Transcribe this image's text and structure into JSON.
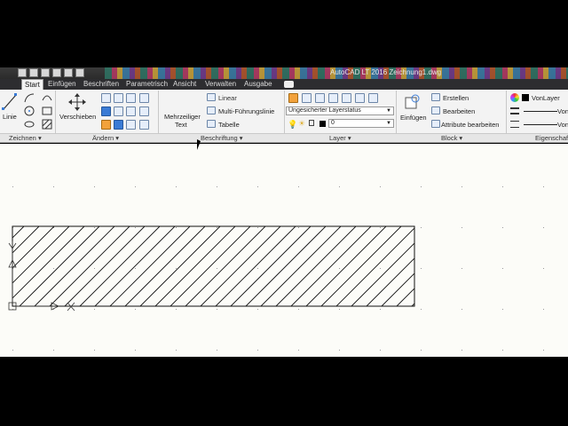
{
  "window": {
    "title": "AutoCAD LT 2016    Zeichnung1.dwg"
  },
  "tabs": [
    "Start",
    "Einfügen",
    "Beschriften",
    "Parametrisch",
    "Ansicht",
    "Verwalten",
    "Ausgabe"
  ],
  "ribbon": {
    "zeichnen": {
      "linie": "Linie"
    },
    "aendern": {
      "verschieben": "Verschieben"
    },
    "beschriftung": {
      "mehrzeiliger": "Mehrzeiliger",
      "text": "Text",
      "linear": "Linear",
      "multi": "Multi-Führungslinie",
      "tabelle": "Tabelle"
    },
    "layer": {
      "status": "Ungesicherter Layerstatus",
      "current": "0"
    },
    "block": {
      "einfuegen": "Einfügen",
      "erstellen": "Erstellen",
      "bearbeiten": "Bearbeiten",
      "attribute": "Attribute bearbeiten"
    },
    "eigenschaften": {
      "vonlayer": "VonLayer",
      "von1": "Von",
      "von2": "Von"
    }
  },
  "panels": [
    "Zeichnen",
    "Ändern",
    "Beschriftung",
    "Layer",
    "Block",
    "Eigenschaft"
  ],
  "colors": {
    "ribbon_bg": "#f3f3f3",
    "canvas_bg": "#fcfcf8",
    "hatch": "#111111"
  }
}
